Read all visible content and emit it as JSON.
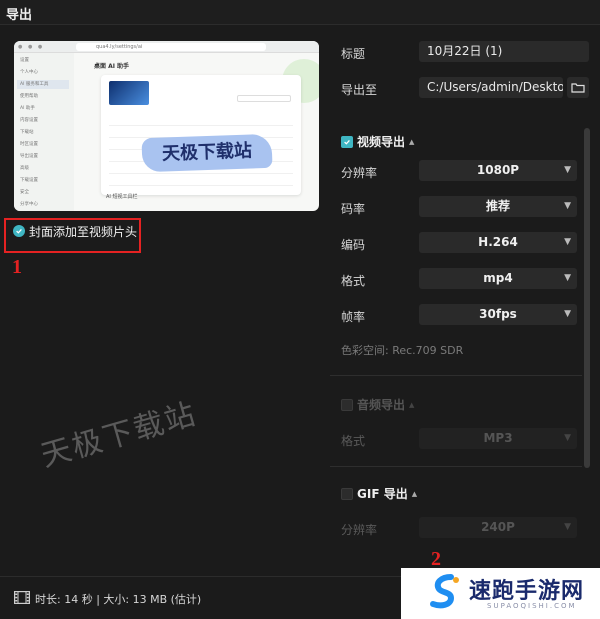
{
  "window": {
    "title": "导出"
  },
  "preview": {
    "watermark_text": "天极下载站",
    "app_title": "桌面 AI 助手",
    "url": "qua4.ly/settings/ai",
    "sidebar_items": [
      "设置",
      "个人中心",
      "AI 服务和工具",
      "使用帮助",
      "AI 助手",
      "内容设置",
      "下载站",
      "时区设置",
      "导出设置",
      "高级",
      "下载设置",
      "安全",
      "分享中心"
    ],
    "section_caption": "AI 短视工具栏"
  },
  "cover": {
    "label": "封面添加至视频片头",
    "checked": true
  },
  "annotations": {
    "marker_1": "1",
    "marker_2": "2"
  },
  "background_watermark": "天极下载站",
  "form": {
    "title_label": "标题",
    "title_value": "10月22日 (1)",
    "export_to_label": "导出至",
    "export_path": "C:/Users/admin/Deskto..."
  },
  "video_export": {
    "section_label": "视频导出",
    "checked": true,
    "fields": [
      {
        "label": "分辨率",
        "value": "1080P"
      },
      {
        "label": "码率",
        "value": "推荐"
      },
      {
        "label": "编码",
        "value": "H.264"
      },
      {
        "label": "格式",
        "value": "mp4"
      },
      {
        "label": "帧率",
        "value": "30fps"
      }
    ],
    "color_space": "色彩空间:  Rec.709 SDR"
  },
  "audio_export": {
    "section_label": "音频导出",
    "checked": false,
    "format_label": "格式",
    "format_value": "MP3"
  },
  "gif_export": {
    "section_label": "GIF 导出",
    "checked": false,
    "resolution_label": "分辨率",
    "resolution_value": "240P"
  },
  "footer": {
    "info": "时长:  14 秒 | 大小:  13 MB  (估计)"
  },
  "logo": {
    "main": "速跑手游网",
    "sub": "SUPAOQISHI.COM"
  },
  "colors": {
    "accent": "#3fb6c3",
    "annotation_red": "#e52222",
    "background": "#1b1b1b"
  }
}
